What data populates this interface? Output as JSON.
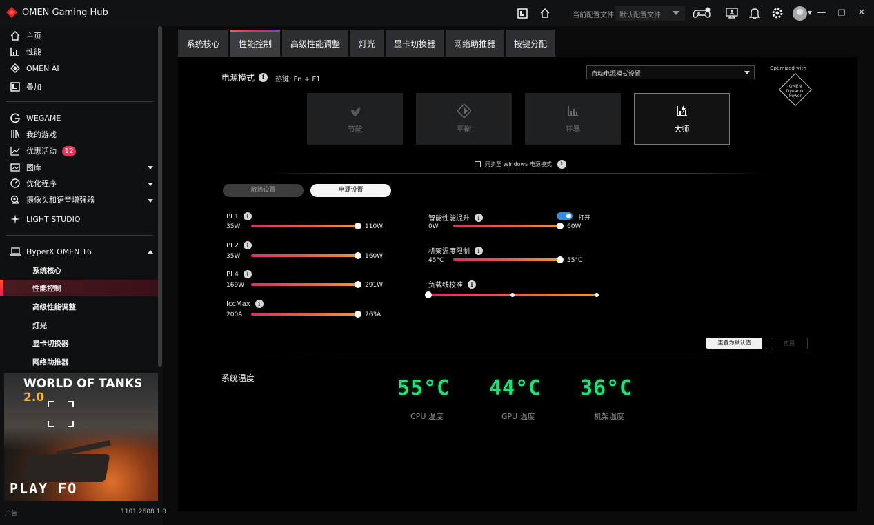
{
  "app": {
    "title": "OMEN Gaming Hub"
  },
  "header": {
    "profile_label": "当前配置文件",
    "profile_value": "默认配置文件"
  },
  "sidebar": {
    "items": [
      {
        "label": "主页",
        "icon": "home-icon"
      },
      {
        "label": "性能",
        "icon": "bar-chart-icon"
      },
      {
        "label": "OMEN AI",
        "icon": "diamond-icon"
      },
      {
        "label": "叠加",
        "icon": "overlay-icon"
      },
      {
        "label": "WEGAME",
        "icon": "wegame-icon"
      },
      {
        "label": "我的游戏",
        "icon": "library-icon"
      },
      {
        "label": "优惠活动",
        "icon": "trend-icon",
        "badge": "12"
      },
      {
        "label": "图库",
        "icon": "gallery-icon"
      },
      {
        "label": "优化程序",
        "icon": "gauge-icon"
      },
      {
        "label": "摄像头和语音增强器",
        "icon": "camera-icon"
      },
      {
        "label": "LIGHT STUDIO",
        "icon": "sparkle-icon"
      },
      {
        "label": "HyperX OMEN 16",
        "icon": "laptop-icon"
      }
    ],
    "sub_items": [
      "系统核心",
      "性能控制",
      "高级性能调整",
      "灯光",
      "显卡切换器",
      "网络助推器"
    ],
    "ad": {
      "brand": "WORLD OF TANKS",
      "brand_version": "2.0",
      "cta": "PLAY FO",
      "label": "广告"
    },
    "version": "1101.2608.1.0"
  },
  "tabs": [
    "系统核心",
    "性能控制",
    "高级性能调整",
    "灯光",
    "显卡切换器",
    "网络助推器",
    "按键分配"
  ],
  "power_mode": {
    "title": "电源模式",
    "hotkey": "热键: Fn + F1",
    "auto_setting": "自动电源模式设置",
    "optimized_with": "Optimized with",
    "omen_logo": "OMEN Dynamic Power",
    "modes": [
      {
        "label": "节能",
        "icon": "leaf-icon",
        "active": false
      },
      {
        "label": "平衡",
        "icon": "balance-icon",
        "active": false
      },
      {
        "label": "狂暴",
        "icon": "performance-icon",
        "active": false
      },
      {
        "label": "大师",
        "icon": "unleashed-icon",
        "active": true
      }
    ],
    "sync_windows": "同步至 Windows 电源模式"
  },
  "settings_tabs": {
    "cooling": "散热设置",
    "power": "电源设置"
  },
  "sliders_left": [
    {
      "name": "PL1",
      "min": "35W",
      "max": "110W",
      "value": 110,
      "range": [
        35,
        110
      ]
    },
    {
      "name": "PL2",
      "min": "35W",
      "max": "160W",
      "value": 160,
      "range": [
        35,
        160
      ]
    },
    {
      "name": "PL4",
      "min": "169W",
      "max": "291W",
      "value": 291,
      "range": [
        169,
        291
      ]
    },
    {
      "name": "IccMax",
      "min": "200A",
      "max": "263A",
      "value": 263,
      "range": [
        200,
        263
      ]
    }
  ],
  "sliders_right": [
    {
      "name": "智能性能提升",
      "min": "0W",
      "max": "60W",
      "value": 60,
      "range": [
        0,
        60
      ]
    },
    {
      "name": "机架温度限制",
      "min": "45°C",
      "max": "55°C",
      "value": 55,
      "range": [
        45,
        55
      ]
    }
  ],
  "load_line": {
    "name": "负载线校准",
    "steps": 3,
    "value_step": 0
  },
  "smart_boost_toggle": {
    "label": "打开",
    "on": true
  },
  "buttons": {
    "reset": "重置为默认值",
    "apply": "应用"
  },
  "system_temp": {
    "title": "系统温度",
    "readings": [
      {
        "value": "55°C",
        "label": "CPU 温度"
      },
      {
        "value": "44°C",
        "label": "GPU 温度"
      },
      {
        "value": "36°C",
        "label": "机架温度"
      }
    ]
  },
  "colors": {
    "accent_red": "#e8485e",
    "temp_green": "#23e07a",
    "toggle_blue": "#3a8ae0"
  }
}
